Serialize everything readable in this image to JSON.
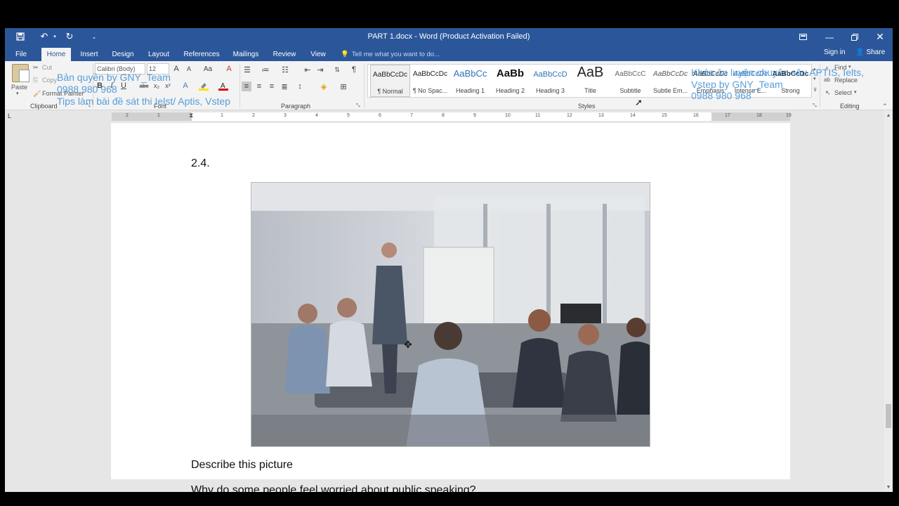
{
  "window": {
    "title": "PART 1.docx - Word (Product Activation Failed)"
  },
  "tabs": [
    {
      "label": "File"
    },
    {
      "label": "Home"
    },
    {
      "label": "Insert"
    },
    {
      "label": "Design"
    },
    {
      "label": "Layout"
    },
    {
      "label": "References"
    },
    {
      "label": "Mailings"
    },
    {
      "label": "Review"
    },
    {
      "label": "View"
    }
  ],
  "tell_me": "Tell me what you want to do...",
  "sign_in": "Sign in",
  "share": "Share",
  "clipboard": {
    "paste": "Paste",
    "cut": "Cut",
    "copy": "Copy",
    "format_painter": "Format Painter",
    "label": "Clipboard"
  },
  "font": {
    "name": "Calibri (Body)",
    "size": "12",
    "label": "Font"
  },
  "paragraph": {
    "label": "Paragraph"
  },
  "styles": {
    "label": "Styles",
    "items": [
      {
        "sample": "AaBbCcDc",
        "name": "¶ Normal"
      },
      {
        "sample": "AaBbCcDc",
        "name": "¶ No Spac..."
      },
      {
        "sample": "AaBbCc",
        "name": "Heading 1"
      },
      {
        "sample": "AaBb",
        "name": "Heading 2"
      },
      {
        "sample": "AaBbCcD",
        "name": "Heading 3"
      },
      {
        "sample": "AaB",
        "name": "Title"
      },
      {
        "sample": "AaBbCcC",
        "name": "Subtitle"
      },
      {
        "sample": "AaBbCcDc",
        "name": "Subtle Em..."
      },
      {
        "sample": "AaBbCcDc",
        "name": "Emphasis"
      },
      {
        "sample": "AaBbCcDc",
        "name": "Intense E..."
      },
      {
        "sample": "AaBbCcDc",
        "name": "Strong"
      }
    ]
  },
  "editing": {
    "find": "Find",
    "replace": "Replace",
    "select": "Select",
    "label": "Editing"
  },
  "watermarks": {
    "left_line1": "Bản quyền by GNY_Team",
    "left_line2": "0988 980 968",
    "left_line3": "Tips làm bài đề sát thi Ielst/ Aptis, Vstep",
    "right_line1": "Khóa ôn luyện chuyên sâu APTIS, Ielts,",
    "right_line2": "Vstep by GNY_Team",
    "right_line3": "0988 980 968"
  },
  "ruler": {
    "numbers": [
      "2",
      "1",
      "1",
      "2",
      "3",
      "4",
      "5",
      "6",
      "7",
      "8",
      "9",
      "10",
      "11",
      "12",
      "13",
      "14",
      "15",
      "16",
      "17",
      "18",
      "19"
    ],
    "tab_selector": "L"
  },
  "document": {
    "heading_number": "2.4.",
    "caption": "Describe this picture",
    "question": "Why do some people feel worried about public speaking?"
  },
  "colors": {
    "word_blue": "#2b579a",
    "watermark": "#3a8fd6"
  }
}
